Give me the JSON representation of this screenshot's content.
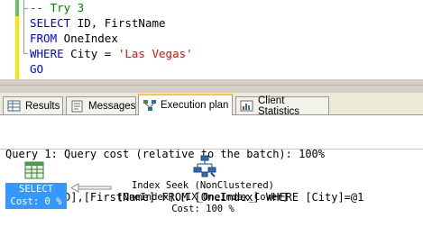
{
  "editor": {
    "lines": [
      {
        "text": "-- Try 3"
      },
      {
        "kw": "SELECT",
        "rest": " ID, FirstName"
      },
      {
        "kw": "FROM",
        "rest": " OneIndex"
      },
      {
        "kw": "WHERE",
        "rest": " City = ",
        "str": "'Las Vegas'"
      },
      {
        "kw": "GO"
      }
    ]
  },
  "tabs": [
    {
      "label": "Results",
      "icon": "grid-icon"
    },
    {
      "label": "Messages",
      "icon": "messages-icon"
    },
    {
      "label": "Execution plan",
      "icon": "execution-plan-icon",
      "active": true
    },
    {
      "label": "Client Statistics",
      "icon": "statistics-icon"
    }
  ],
  "plan": {
    "query_cost": "Query 1: Query cost (relative to the batch): 100%",
    "query_text": "SELECT [ID],[FirstName] FROM [OneIndex] WHERE [City]=@1",
    "select_node": {
      "label": "SELECT",
      "cost": "Cost: 0 %"
    },
    "seek_node": {
      "operator": "Index Seek (NonClustered)",
      "object": "[OneIndex].[IX_OneIndex_Cover]",
      "cost": "Cost: 100 %"
    }
  },
  "colors": {
    "selected_node": "#3399ff",
    "comment": "#008000",
    "string": "#ff0000",
    "keyword": "#0000ff"
  }
}
